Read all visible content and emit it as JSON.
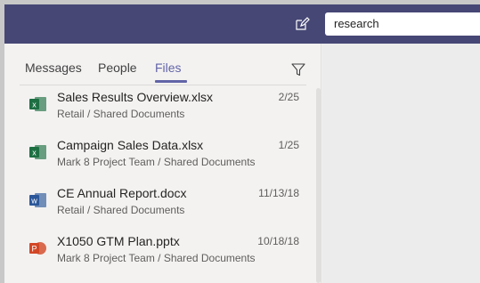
{
  "search": {
    "value": "research"
  },
  "tabs": [
    {
      "label": "Messages",
      "active": false
    },
    {
      "label": "People",
      "active": false
    },
    {
      "label": "Files",
      "active": true
    }
  ],
  "files": [
    {
      "name": "Sales Results Overview.xlsx",
      "path": "Retail / Shared Documents",
      "date": "2/25",
      "type": "excel",
      "icon_letter": "x",
      "color": "#1d6f42"
    },
    {
      "name": "Campaign Sales Data.xlsx",
      "path": "Mark 8 Project Team / Shared Documents",
      "date": "1/25",
      "type": "excel",
      "icon_letter": "x",
      "color": "#1d6f42"
    },
    {
      "name": "CE Annual Report.docx",
      "path": "Retail / Shared Documents",
      "date": "11/13/18",
      "type": "word",
      "icon_letter": "w",
      "color": "#2b579a"
    },
    {
      "name": "X1050 GTM Plan.pptx",
      "path": "Mark 8 Project Team / Shared Documents",
      "date": "10/18/18",
      "type": "powerpoint",
      "icon_letter": "P",
      "color": "#d24726"
    }
  ],
  "colors": {
    "brand": "#464775",
    "accent": "#6264a7"
  },
  "icons": {
    "compose": "compose-icon",
    "filter": "filter-icon"
  }
}
